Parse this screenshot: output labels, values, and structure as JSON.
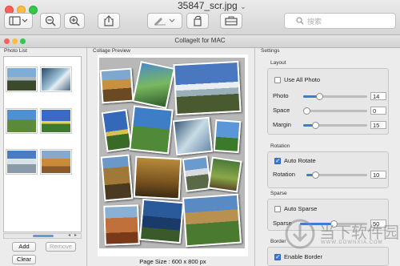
{
  "window": {
    "file_title": "35847_scr.jpg",
    "app_title": "CollageIt for MAC",
    "search_placeholder": "搜索"
  },
  "toolbar": {
    "icons": [
      "sidebar-icon",
      "zoom-out-icon",
      "zoom-in-icon",
      "share-icon",
      "pen-icon",
      "rotate-icon",
      "toolbox-icon",
      "search-icon"
    ]
  },
  "photo_list": {
    "label": "Photo List",
    "add_label": "Add",
    "remove_label": "Remove",
    "clear_label": "Clear"
  },
  "preview": {
    "label": "Collage Preview",
    "page_size": "Page Size : 600 x 800 px"
  },
  "settings": {
    "label": "Settings",
    "layout": {
      "title": "Layout",
      "use_all_photo": "Use All Photo",
      "photo_label": "Photo",
      "photo_value": "14",
      "space_label": "Space",
      "space_value": "0",
      "margin_label": "Margin",
      "margin_value": "15"
    },
    "rotation": {
      "title": "Rotation",
      "auto_rotate": "Auto Rotate",
      "rotation_label": "Rotation",
      "rotation_value": "10"
    },
    "sparse": {
      "title": "Sparse",
      "auto_sparse": "Auto Sparse",
      "sparse_label": "Sparse",
      "sparse_value": "50"
    },
    "border": {
      "title": "Border",
      "enable_border": "Enable Border"
    }
  },
  "watermark": {
    "text": "当下软件园",
    "sub": "WWW.DOWNXIA.COM"
  },
  "levels": {
    "photo_slider": 0.22,
    "space_slider": 0.0,
    "margin_slider": 0.15,
    "rotation_slider": 0.1,
    "sparse_slider": 0.5
  },
  "colors": {
    "accent": "#3d7bd9",
    "close": "#fc605c",
    "minimize": "#fdbc40",
    "zoom": "#34c84a"
  }
}
